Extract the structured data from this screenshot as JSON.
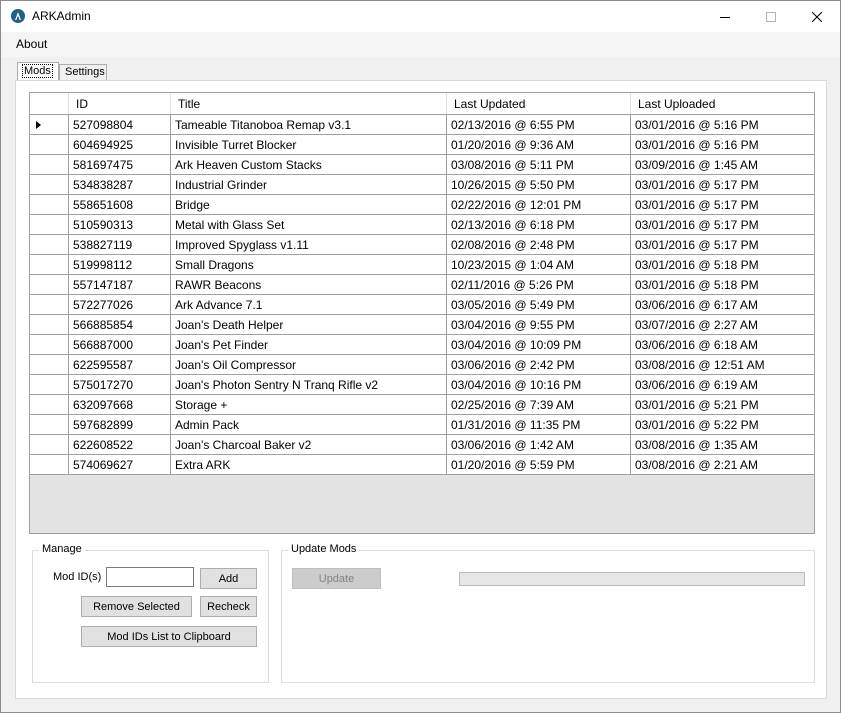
{
  "window": {
    "title": "ARKAdmin"
  },
  "menu": {
    "items": [
      {
        "label": "About"
      }
    ]
  },
  "tabs": [
    {
      "label": "Mods",
      "active": true
    },
    {
      "label": "Settings",
      "active": false
    }
  ],
  "grid": {
    "columns": [
      "",
      "ID",
      "Title",
      "Last Updated",
      "Last Uploaded"
    ],
    "selected_row": 0,
    "rows": [
      {
        "id": "527098804",
        "title": "Tameable Titanoboa Remap v3.1",
        "last_updated": "02/13/2016 @ 6:55 PM",
        "last_uploaded": "03/01/2016 @ 5:16 PM"
      },
      {
        "id": "604694925",
        "title": "Invisible Turret Blocker",
        "last_updated": "01/20/2016 @ 9:36 AM",
        "last_uploaded": "03/01/2016 @ 5:16 PM"
      },
      {
        "id": "581697475",
        "title": "Ark Heaven Custom Stacks",
        "last_updated": "03/08/2016 @ 5:11 PM",
        "last_uploaded": "03/09/2016 @ 1:45 AM"
      },
      {
        "id": "534838287",
        "title": "Industrial Grinder",
        "last_updated": "10/26/2015 @ 5:50 PM",
        "last_uploaded": "03/01/2016 @ 5:17 PM"
      },
      {
        "id": "558651608",
        "title": "Bridge",
        "last_updated": "02/22/2016 @ 12:01 PM",
        "last_uploaded": "03/01/2016 @ 5:17 PM"
      },
      {
        "id": "510590313",
        "title": "Metal with Glass Set",
        "last_updated": "02/13/2016 @ 6:18 PM",
        "last_uploaded": "03/01/2016 @ 5:17 PM"
      },
      {
        "id": "538827119",
        "title": "Improved Spyglass v1.11",
        "last_updated": "02/08/2016 @ 2:48 PM",
        "last_uploaded": "03/01/2016 @ 5:17 PM"
      },
      {
        "id": "519998112",
        "title": "Small Dragons",
        "last_updated": "10/23/2015 @ 1:04 AM",
        "last_uploaded": "03/01/2016 @ 5:18 PM"
      },
      {
        "id": "557147187",
        "title": "RAWR Beacons",
        "last_updated": "02/11/2016 @ 5:26 PM",
        "last_uploaded": "03/01/2016 @ 5:18 PM"
      },
      {
        "id": "572277026",
        "title": "Ark Advance 7.1",
        "last_updated": "03/05/2016 @ 5:49 PM",
        "last_uploaded": "03/06/2016 @ 6:17 AM"
      },
      {
        "id": "566885854",
        "title": "Joan's Death Helper",
        "last_updated": "03/04/2016 @ 9:55 PM",
        "last_uploaded": "03/07/2016 @ 2:27 AM"
      },
      {
        "id": "566887000",
        "title": "Joan's Pet Finder",
        "last_updated": "03/04/2016 @ 10:09 PM",
        "last_uploaded": "03/06/2016 @ 6:18 AM"
      },
      {
        "id": "622595587",
        "title": "Joan's Oil Compressor",
        "last_updated": "03/06/2016 @ 2:42 PM",
        "last_uploaded": "03/08/2016 @ 12:51 AM"
      },
      {
        "id": "575017270",
        "title": "Joan's Photon Sentry N Tranq Rifle v2",
        "last_updated": "03/04/2016 @ 10:16 PM",
        "last_uploaded": "03/06/2016 @ 6:19 AM"
      },
      {
        "id": "632097668",
        "title": "Storage +",
        "last_updated": "02/25/2016 @ 7:39 AM",
        "last_uploaded": "03/01/2016 @ 5:21 PM"
      },
      {
        "id": "597682899",
        "title": "Admin Pack",
        "last_updated": "01/31/2016 @ 11:35 PM",
        "last_uploaded": "03/01/2016 @ 5:22 PM"
      },
      {
        "id": "622608522",
        "title": "Joan's Charcoal Baker v2",
        "last_updated": "03/06/2016 @ 1:42 AM",
        "last_uploaded": "03/08/2016 @ 1:35 AM"
      },
      {
        "id": "574069627",
        "title": "Extra ARK",
        "last_updated": "01/20/2016 @ 5:59 PM",
        "last_uploaded": "03/08/2016 @ 2:21 AM"
      }
    ]
  },
  "manage": {
    "group_label": "Manage",
    "mod_ids_label": "Mod ID(s)",
    "mod_ids_value": "",
    "add_label": "Add",
    "remove_selected_label": "Remove Selected",
    "recheck_label": "Recheck",
    "copy_list_label": "Mod IDs List to Clipboard"
  },
  "update": {
    "group_label": "Update Mods",
    "update_label": "Update",
    "update_enabled": false,
    "progress": 0
  },
  "colors": {
    "accent": "#1f5f8b",
    "progress": "#06b025"
  }
}
